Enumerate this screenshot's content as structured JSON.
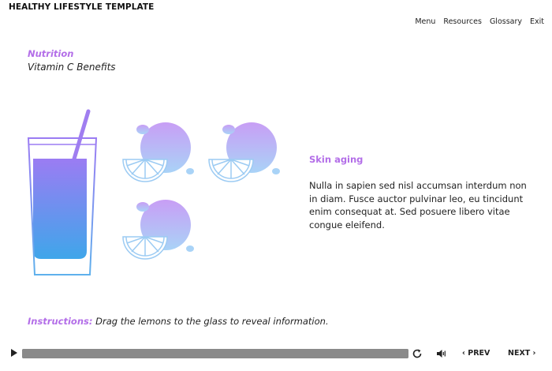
{
  "app": {
    "title": "HEALTHY LIFESTYLE TEMPLATE"
  },
  "nav": {
    "items": [
      "Menu",
      "Resources",
      "Glossary",
      "Exit"
    ]
  },
  "slide": {
    "section": "Nutrition",
    "subtitle": "Vitamin C Benefits"
  },
  "info": {
    "heading": "Skin aging",
    "body": "Nulla in sapien sed nisl accumsan interdum non in diam. Fusce auctor pulvinar leo, eu tincidunt enim consequat at. Sed posuere libero vitae congue eleifend."
  },
  "instructions": {
    "label": "Instructions:",
    "text": "Drag the lemons to the glass to reveal information."
  },
  "player": {
    "progress": 1.0,
    "prev_label": "PREV",
    "next_label": "NEXT",
    "prev_icon": "chevron-left-icon",
    "next_icon": "chevron-right-icon"
  },
  "colors": {
    "accent": "#b36ee8",
    "gradient_top": "#b17cf2",
    "gradient_bottom": "#3fa6ea",
    "lemon_top": "#caa0f5",
    "lemon_bottom": "#a8d4f7"
  }
}
